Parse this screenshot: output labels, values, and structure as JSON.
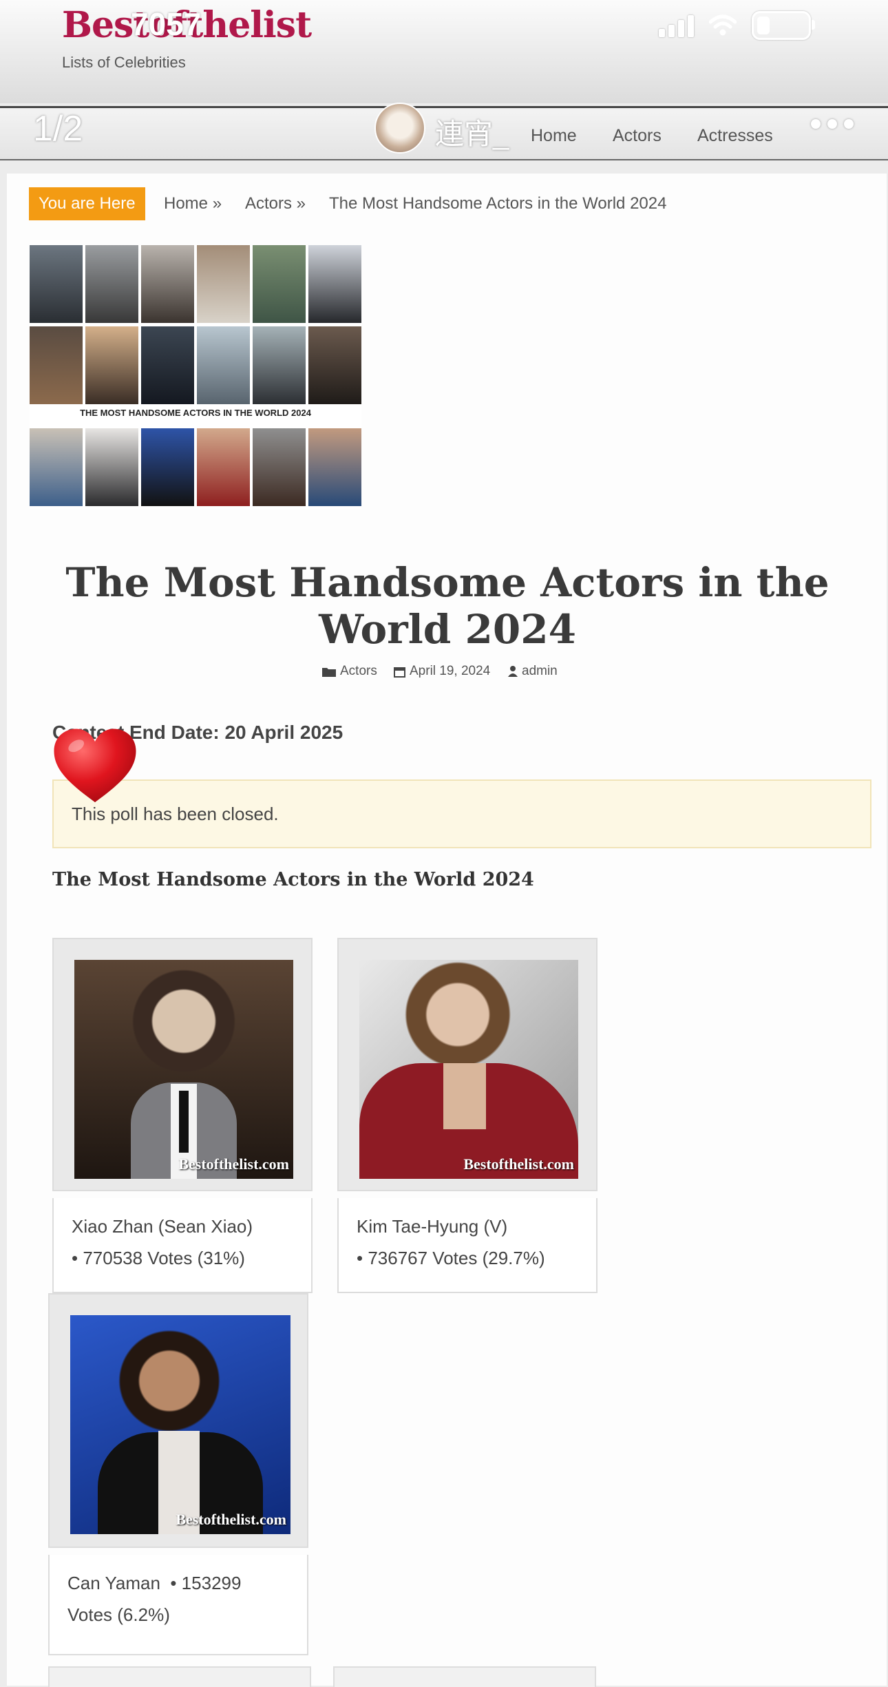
{
  "status_bar": {
    "time": "7057"
  },
  "site": {
    "logo": "Bestofthelist",
    "tagline": "Lists of Celebrities"
  },
  "viewer": {
    "page_counter": "1/2",
    "username": "連宵_"
  },
  "nav": {
    "items": [
      "Home",
      "Actors",
      "Actresses"
    ]
  },
  "breadcrumb": {
    "label": "You are Here",
    "items": [
      "Home »",
      "Actors »",
      "The Most Handsome Actors in the World 2024"
    ]
  },
  "collage": {
    "caption": "THE MOST HANDSOME ACTORS IN THE WORLD 2024"
  },
  "article": {
    "title": "The Most Handsome Actors in the World 2024",
    "category": "Actors",
    "date": "April 19, 2024",
    "author": "admin"
  },
  "contest": {
    "end_date": "Contest End Date: 20 April 2025"
  },
  "poll": {
    "closed_message": "This poll has been closed.",
    "title": "The Most Handsome Actors in the World 2024",
    "watermark": "Bestofthelist.com",
    "entries": [
      {
        "name": "Xiao Zhan (Sean Xiao)",
        "votes_text": "• 770538 Votes (31%)",
        "votes": 770538,
        "percent": 31
      },
      {
        "name": "Kim Tae-Hyung (V)",
        "votes_text": "• 736767 Votes (29.7%)",
        "votes": 736767,
        "percent": 29.7
      },
      {
        "name": "Can Yaman",
        "votes_text": "• 153299 Votes (6.2%)",
        "votes": 153299,
        "percent": 6.2
      }
    ]
  },
  "colors": {
    "brand": "#b0184a",
    "breadcrumb_badge": "#f39b13",
    "notice_bg": "#fdf8e4",
    "heart": "#e0151e"
  }
}
